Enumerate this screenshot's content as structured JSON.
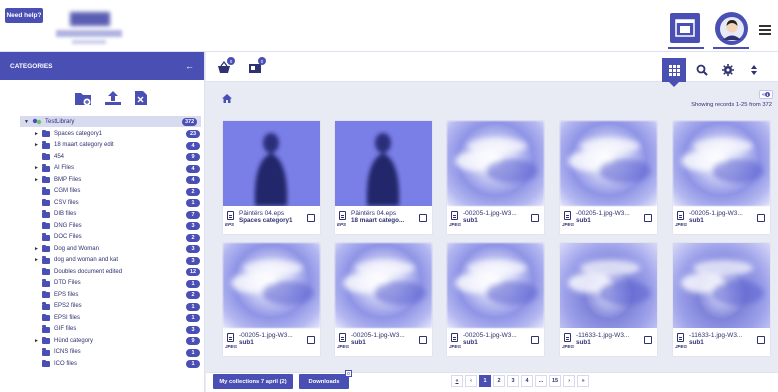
{
  "header": {
    "help_label": "Need help?"
  },
  "sidebar": {
    "title": "CATEGORIES",
    "collapse_arrow": "←",
    "root": {
      "label": "TestLibrary",
      "count": "372"
    },
    "items": [
      {
        "label": "Spaces category1",
        "count": "23",
        "expandable": true
      },
      {
        "label": "18 maart category edit",
        "count": "4",
        "expandable": true
      },
      {
        "label": "454",
        "count": "9",
        "expandable": false
      },
      {
        "label": "AI Files",
        "count": "4",
        "expandable": true
      },
      {
        "label": "BMP Files",
        "count": "4",
        "expandable": true
      },
      {
        "label": "CGM files",
        "count": "2",
        "expandable": false
      },
      {
        "label": "CSV files",
        "count": "1",
        "expandable": false
      },
      {
        "label": "DIB files",
        "count": "7",
        "expandable": false
      },
      {
        "label": "DNG Files",
        "count": "3",
        "expandable": false
      },
      {
        "label": "DOC Files",
        "count": "2",
        "expandable": false
      },
      {
        "label": "Dog and Woman",
        "count": "3",
        "expandable": true
      },
      {
        "label": "dog and woman and kat",
        "count": "3",
        "expandable": true
      },
      {
        "label": "Doubles document edited",
        "count": "12",
        "expandable": false
      },
      {
        "label": "DTD Files",
        "count": "1",
        "expandable": false
      },
      {
        "label": "EPS files",
        "count": "2",
        "expandable": false
      },
      {
        "label": "EPS2 files",
        "count": "1",
        "expandable": false
      },
      {
        "label": "EPSI files",
        "count": "1",
        "expandable": false
      },
      {
        "label": "GIF files",
        "count": "3",
        "expandable": false
      },
      {
        "label": "Hünd category",
        "count": "9",
        "expandable": true
      },
      {
        "label": "ICNS files",
        "count": "1",
        "expandable": false
      },
      {
        "label": "ICO files",
        "count": "1",
        "expandable": false
      }
    ]
  },
  "toolbar": {
    "basket_count": "0",
    "lightbox_count": "0"
  },
  "content": {
    "showing": "Showing records 1-25 from 372",
    "collapse_label": "«",
    "cards": [
      {
        "name": "Päintërs 04.eps",
        "sub": "Spaces category1",
        "type": "EPS",
        "thumb": "person"
      },
      {
        "name": "Päintërs 04.eps",
        "sub": "18 maart catego...",
        "type": "EPS",
        "thumb": "person"
      },
      {
        "name": "-00205-1.jpg-W3...",
        "sub": "sub1",
        "type": "JPEG",
        "thumb": "blur"
      },
      {
        "name": "-00205-1.jpg-W3...",
        "sub": "sub1",
        "type": "JPEG",
        "thumb": "blur"
      },
      {
        "name": "-00205-1.jpg-W3...",
        "sub": "sub1",
        "type": "JPEG",
        "thumb": "blur"
      },
      {
        "name": "-00205-1.jpg-W3...",
        "sub": "sub1",
        "type": "JPEG",
        "thumb": "blur"
      },
      {
        "name": "-00205-1.jpg-W3...",
        "sub": "sub1",
        "type": "JPEG",
        "thumb": "blur"
      },
      {
        "name": "-00205-1.jpg-W3...",
        "sub": "sub1",
        "type": "JPEG",
        "thumb": "blur"
      },
      {
        "name": "-11633-1.jpg-W3...",
        "sub": "sub1",
        "type": "JPEG",
        "thumb": "blur2"
      },
      {
        "name": "-11633-1.jpg-W3...",
        "sub": "sub1",
        "type": "JPEG",
        "thumb": "blur2"
      }
    ]
  },
  "footer": {
    "collections_label": "My collections 7 april (2)",
    "downloads_label": "Downloads",
    "downloads_count": "0",
    "pages": [
      "«",
      "‹",
      "1",
      "2",
      "3",
      "4",
      "...",
      "15",
      "›",
      "»"
    ],
    "active_page": "1"
  },
  "colors": {
    "accent": "#4a4fb4",
    "text": "#2f3270",
    "background": "#e9ebf4"
  }
}
